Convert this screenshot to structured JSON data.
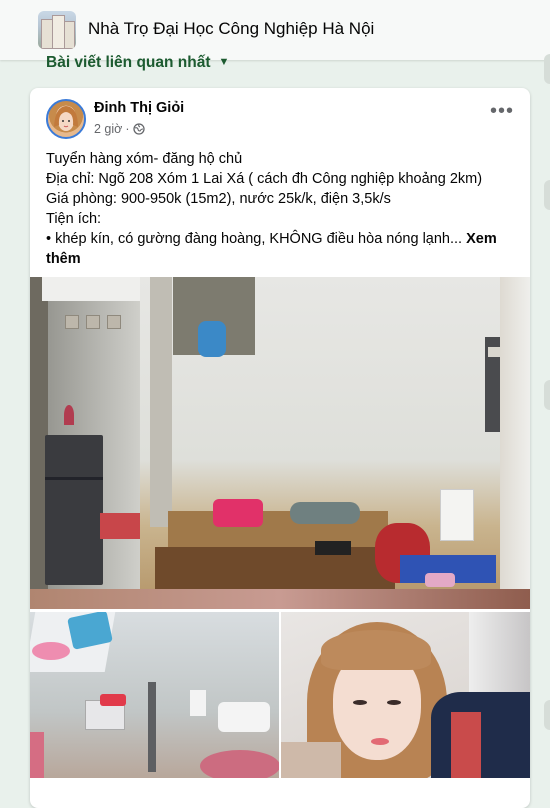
{
  "group": {
    "title": "Nhà Trọ Đại Học Công Nghiệp Hà Nội",
    "icon": "group-photo-icon"
  },
  "feed": {
    "sort_label": "Bài viết liên quan nhất",
    "sort_icon": "caret-down-icon"
  },
  "post": {
    "author": "Đinh Thị Giỏi",
    "time": "2 giờ",
    "privacy_icon": "public-globe-icon",
    "more_icon": "more-options-icon",
    "lines": [
      "Tuyển hàng xóm- đăng hộ chủ",
      "Địa chỉ: Ngõ 208 Xóm 1 Lai Xá ( cách đh Công nghiệp khoảng 2km)",
      "Giá phòng: 900-950k (15m2), nước 25k/k, điện 3,5k/s",
      "Tiện ích:",
      "• khép kín, có gường đàng hoàng, KHÔNG điều hòa nóng lạnh..."
    ],
    "see_more": "Xem thêm",
    "images": [
      "room-photo",
      "bathroom-photo",
      "selfie-photo"
    ]
  },
  "colors": {
    "page_bg": "#e9f1ec",
    "header_bg": "#f7f9f8",
    "sort_text": "#1c5b30",
    "avatar_ring": "#3b7bd8",
    "muted_text": "#65676b"
  }
}
